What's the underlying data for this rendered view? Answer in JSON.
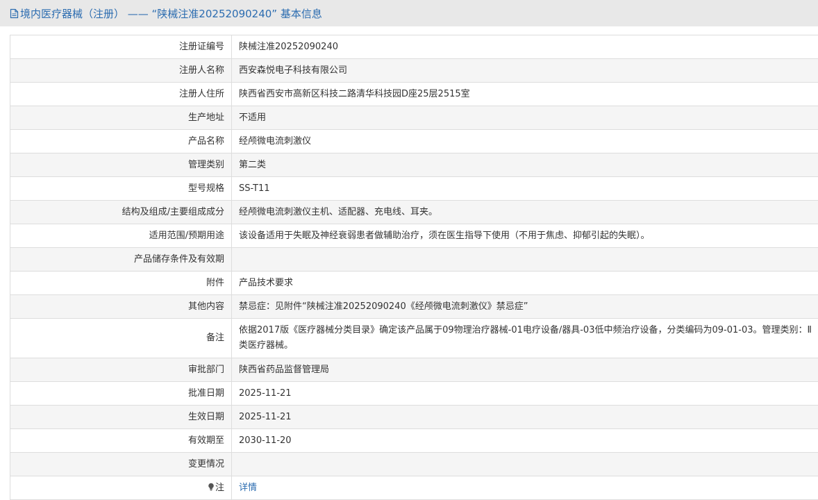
{
  "header": {
    "title": "境内医疗器械（注册） —— “陕械注准20252090240” 基本信息"
  },
  "rows": [
    {
      "label": "注册证编号",
      "value": "陕械注准20252090240"
    },
    {
      "label": "注册人名称",
      "value": "西安森悦电子科技有限公司"
    },
    {
      "label": "注册人住所",
      "value": "陕西省西安市高新区科技二路清华科技园D座25层2515室"
    },
    {
      "label": "生产地址",
      "value": "不适用"
    },
    {
      "label": "产品名称",
      "value": "经颅微电流刺激仪"
    },
    {
      "label": "管理类别",
      "value": "第二类"
    },
    {
      "label": "型号规格",
      "value": "SS-T11"
    },
    {
      "label": "结构及组成/主要组成成分",
      "value": "经颅微电流刺激仪主机、适配器、充电线、耳夹。"
    },
    {
      "label": "适用范围/预期用途",
      "value": "该设备适用于失眠及神经衰弱患者做辅助治疗，须在医生指导下使用（不用于焦虑、抑郁引起的失眠）。"
    },
    {
      "label": "产品储存条件及有效期",
      "value": ""
    },
    {
      "label": "附件",
      "value": "产品技术要求"
    },
    {
      "label": "其他内容",
      "value": "禁忌症：见附件“陕械注准20252090240《经颅微电流刺激仪》禁忌症”"
    },
    {
      "label": "备注",
      "value": "依据2017版《医疗器械分类目录》确定该产品属于09物理治疗器械-01电疗设备/器具-03低中频治疗设备，分类编码为09-01-03。管理类别：Ⅱ类医疗器械。"
    },
    {
      "label": "审批部门",
      "value": "陕西省药品监督管理局"
    },
    {
      "label": "批准日期",
      "value": "2025-11-21"
    },
    {
      "label": "生效日期",
      "value": "2025-11-21"
    },
    {
      "label": "有效期至",
      "value": "2030-11-20"
    },
    {
      "label": "变更情况",
      "value": ""
    }
  ],
  "note": {
    "label": "注",
    "link_text": "详情"
  }
}
